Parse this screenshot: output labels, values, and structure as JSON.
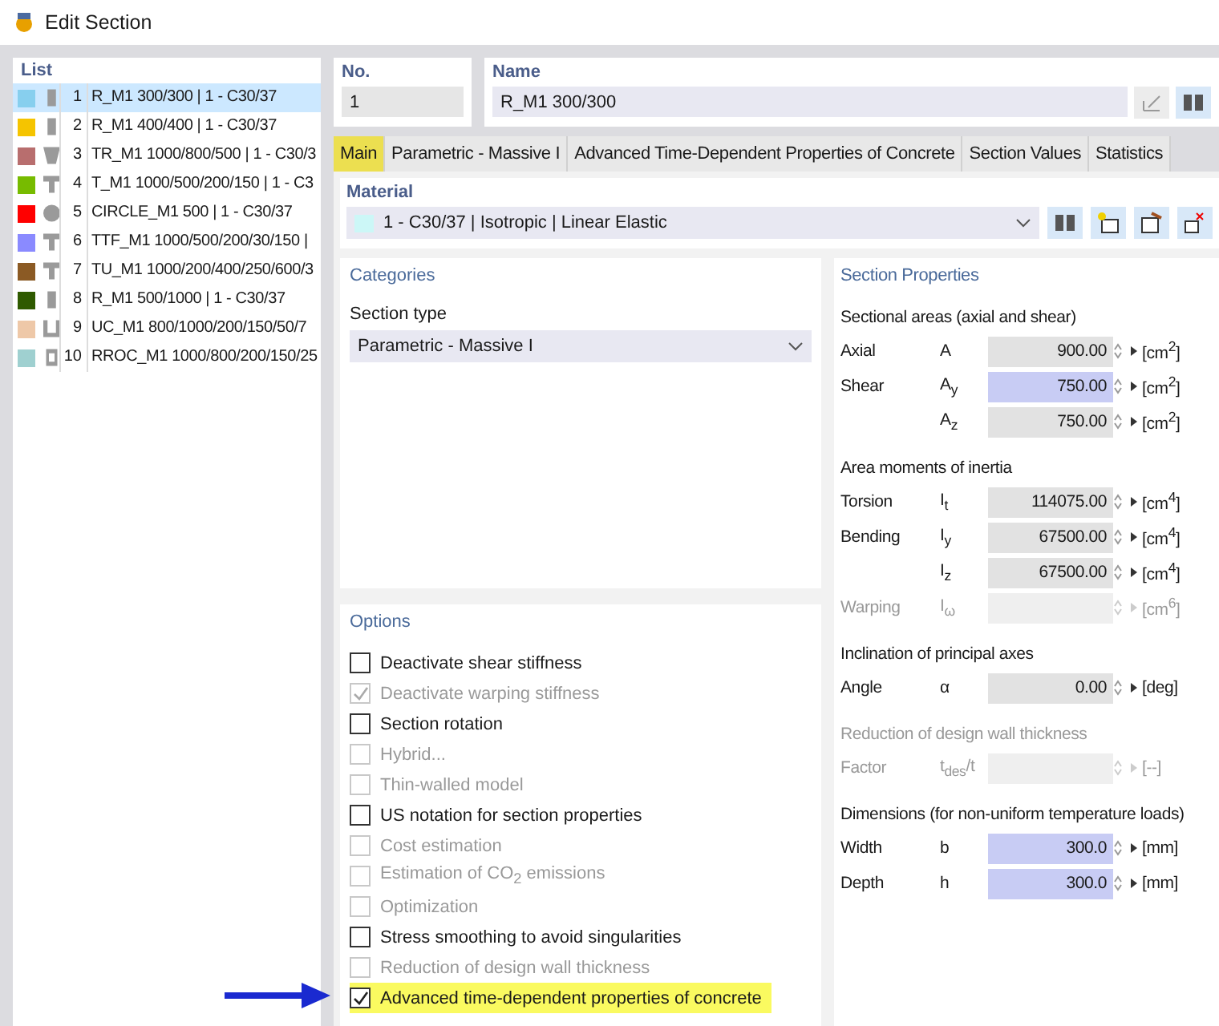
{
  "window": {
    "title": "Edit Section"
  },
  "list": {
    "title": "List",
    "items": [
      {
        "number": "1",
        "name": "R_M1 300/300 | 1 - C30/37",
        "color": "#87cfee",
        "kind": "rect",
        "selected": true
      },
      {
        "number": "2",
        "name": "R_M1 400/400 | 1 - C30/37",
        "color": "#f5c400",
        "kind": "rect",
        "selected": false
      },
      {
        "number": "3",
        "name": "TR_M1 1000/800/500 | 1 - C30/3",
        "color": "#b86e6e",
        "kind": "trapezoid",
        "selected": false
      },
      {
        "number": "4",
        "name": "T_M1 1000/500/200/150 | 1 - C3",
        "color": "#77bb00",
        "kind": "tee",
        "selected": false
      },
      {
        "number": "5",
        "name": "CIRCLE_M1 500 | 1 - C30/37",
        "color": "#ff0000",
        "kind": "circle",
        "selected": false
      },
      {
        "number": "6",
        "name": "TTF_M1 1000/500/200/30/150 |",
        "color": "#8a8aff",
        "kind": "tee",
        "selected": false
      },
      {
        "number": "7",
        "name": "TU_M1 1000/200/400/250/600/3",
        "color": "#8b5a24",
        "kind": "tee",
        "selected": false
      },
      {
        "number": "8",
        "name": "R_M1 500/1000 | 1 - C30/37",
        "color": "#2f5a00",
        "kind": "rect",
        "selected": false
      },
      {
        "number": "9",
        "name": "UC_M1 800/1000/200/150/50/7",
        "color": "#eec8a8",
        "kind": "channel",
        "selected": false
      },
      {
        "number": "10",
        "name": "RROC_M1 1000/800/200/150/25",
        "color": "#9fd0d0",
        "kind": "hollow",
        "selected": false
      }
    ]
  },
  "number": {
    "label": "No.",
    "value": "1"
  },
  "name": {
    "label": "Name",
    "value": "R_M1 300/300"
  },
  "tabs": [
    {
      "label": "Main",
      "selected": true
    },
    {
      "label": "Parametric - Massive I",
      "selected": false
    },
    {
      "label": "Advanced Time-Dependent Properties of Concrete",
      "selected": false
    },
    {
      "label": "Section Values",
      "selected": false
    },
    {
      "label": "Statistics",
      "selected": false
    }
  ],
  "material": {
    "title": "Material",
    "value": "1 - C30/37 | Isotropic | Linear Elastic",
    "color": "#ccf7f7"
  },
  "categories": {
    "title": "Categories",
    "section_type_label": "Section type",
    "section_type": "Parametric - Massive I"
  },
  "options": {
    "title": "Options",
    "items": [
      {
        "label": "Deactivate shear stiffness",
        "checked": false,
        "disabled": false,
        "highlighted": false
      },
      {
        "label": "Deactivate warping stiffness",
        "checked": true,
        "disabled": true,
        "highlighted": false
      },
      {
        "label": "Section rotation",
        "checked": false,
        "disabled": false,
        "highlighted": false
      },
      {
        "label": "Hybrid...",
        "checked": false,
        "disabled": true,
        "highlighted": false
      },
      {
        "label": "Thin-walled model",
        "checked": false,
        "disabled": true,
        "highlighted": false
      },
      {
        "label": "US notation for section properties",
        "checked": false,
        "disabled": false,
        "highlighted": false
      },
      {
        "label": "Cost estimation",
        "checked": false,
        "disabled": true,
        "highlighted": false
      },
      {
        "label": "Estimation of CO$_{2}$ emissions",
        "checked": false,
        "disabled": true,
        "highlighted": false
      },
      {
        "label": "Optimization",
        "checked": false,
        "disabled": true,
        "highlighted": false
      },
      {
        "label": "Stress smoothing to avoid singularities",
        "checked": false,
        "disabled": false,
        "highlighted": false
      },
      {
        "label": "Reduction of design wall thickness",
        "checked": false,
        "disabled": true,
        "highlighted": false
      },
      {
        "label": "Advanced time-dependent properties of concrete",
        "checked": true,
        "disabled": false,
        "highlighted": true
      }
    ]
  },
  "section_properties": {
    "title": "Section Properties",
    "groups": [
      {
        "title": "Sectional areas (axial and shear)",
        "disabled": false,
        "rows": [
          {
            "label": "Axial",
            "symbol": "A",
            "value": "900.00",
            "unit": "[cm$^{2}$]",
            "editable": false,
            "disabled": false
          },
          {
            "label": "Shear",
            "symbol": "A$_{y}$",
            "value": "750.00",
            "unit": "[cm$^{2}$]",
            "editable": true,
            "disabled": false
          },
          {
            "symbol": "A$_{z}$",
            "value": "750.00",
            "unit": "[cm$^{2}$]",
            "editable": false,
            "disabled": false
          }
        ]
      },
      {
        "title": "Area moments of inertia",
        "disabled": false,
        "rows": [
          {
            "label": "Torsion",
            "symbol": "I$_{t}$",
            "value": "114075.00",
            "unit": "[cm$^{4}$]",
            "editable": false,
            "disabled": false
          },
          {
            "label": "Bending",
            "symbol": "I$_{y}$",
            "value": "67500.00",
            "unit": "[cm$^{4}$]",
            "editable": false,
            "disabled": false
          },
          {
            "symbol": "I$_{z}$",
            "value": "67500.00",
            "unit": "[cm$^{4}$]",
            "editable": false,
            "disabled": false
          },
          {
            "label": "Warping",
            "symbol": "I$_{ω}$",
            "unit": "[cm$^{6}$]",
            "disabled": true
          }
        ]
      },
      {
        "title": "Inclination of principal axes",
        "disabled": false,
        "rows": [
          {
            "label": "Angle",
            "symbol": "α",
            "value": "0.00",
            "unit": "[deg]",
            "editable": false,
            "disabled": false
          }
        ]
      },
      {
        "title": "Reduction of design wall thickness",
        "disabled": true,
        "rows": [
          {
            "label": "Factor",
            "symbol": "t$_{des}$/t",
            "unit": "[--]",
            "disabled": true
          }
        ]
      },
      {
        "title": "Dimensions (for non-uniform temperature loads)",
        "disabled": false,
        "rows": [
          {
            "label": "Width",
            "symbol": "b",
            "value": "300.0",
            "unit": "[mm]",
            "editable": true,
            "disabled": false
          },
          {
            "label": "Depth",
            "symbol": "h",
            "value": "300.0",
            "unit": "[mm]",
            "editable": true,
            "disabled": false
          }
        ]
      }
    ]
  }
}
